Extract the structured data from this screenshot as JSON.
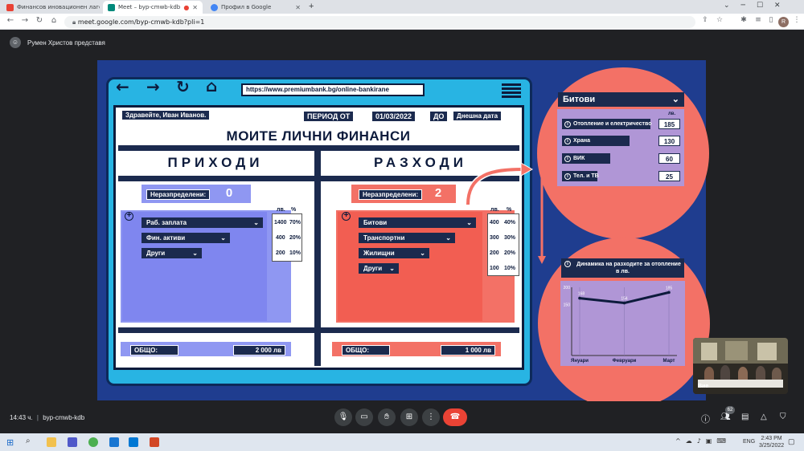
{
  "browser": {
    "tabs": [
      {
        "title": "Финансов иновационен лагер :"
      },
      {
        "title": "Meet – byp-cmwb-kdb"
      },
      {
        "title": "Профил в Google"
      }
    ],
    "url": "meet.google.com/byp-cmwb-kdb?pli=1"
  },
  "meet": {
    "presenter": "Румен Христов представя",
    "time": "14:43 ч.",
    "meeting_code": "byp-cmwb-kdb",
    "participants_count": "62",
    "thumb_label": "Вие"
  },
  "slide": {
    "url": "https://www.premiumbank.bg/online-bankirane",
    "greeting": "Здравейте, Иван Иванов.",
    "period_label": "ПЕРИОД",
    "from_label": "ОТ",
    "from_date": "01/03/2022",
    "to_label": "ДО",
    "to_date": "Днешна дата",
    "title": "МОИТЕ ЛИЧНИ ФИНАНСИ",
    "income": {
      "header": "ПРИХОДИ",
      "unallocated_label": "Неразпределени:",
      "unallocated_value": "0",
      "col_lv": "лв.",
      "col_pct": "%",
      "rows": [
        {
          "label": "Раб. заплата",
          "amount": "1400",
          "pct": "70%"
        },
        {
          "label": "Фин. активи",
          "amount": "400",
          "pct": "20%"
        },
        {
          "label": "Други",
          "amount": "200",
          "pct": "10%"
        }
      ],
      "total_label": "ОБЩО:",
      "total_value": "2 000 лв"
    },
    "expenses": {
      "header": "РАЗХОДИ",
      "unallocated_label": "Неразпределени:",
      "unallocated_value": "2",
      "col_lv": "лв.",
      "col_pct": "%",
      "rows": [
        {
          "label": "Битови",
          "amount": "400",
          "pct": "40%"
        },
        {
          "label": "Транспортни",
          "amount": "300",
          "pct": "30%"
        },
        {
          "label": "Жилищни",
          "amount": "200",
          "pct": "20%"
        },
        {
          "label": "Други",
          "amount": "100",
          "pct": "10%"
        }
      ],
      "total_label": "ОБЩО:",
      "total_value": "1 000 лв"
    },
    "utilities": {
      "dropdown": "Битови",
      "col_lv": "лв.",
      "rows": [
        {
          "label": "Отопление и електричество",
          "value": "185"
        },
        {
          "label": "Храна",
          "value": "130"
        },
        {
          "label": "ВИК",
          "value": "60"
        },
        {
          "label": "Тел. и ТВ",
          "value": "25"
        }
      ]
    },
    "chart_header": "Динамика на разходите за отопление",
    "chart_sub": "в лв."
  },
  "chart_data": {
    "type": "line",
    "categories": [
      "Януари",
      "Февруари",
      "Март"
    ],
    "values": [
      168,
      154,
      185
    ],
    "ylim": [
      0,
      200
    ],
    "yticks": [
      200,
      150
    ],
    "title": "Динамика на разходите за отопление",
    "ylabel": "в лв."
  },
  "taskbar": {
    "lang": "ENG",
    "clock_time": "2:43 PM",
    "clock_date": "3/25/2022"
  },
  "colors": {
    "slide_bg": "#1f3d8f",
    "income": "#8f97f2",
    "expense": "#f37166",
    "dark": "#1b2a4e"
  }
}
